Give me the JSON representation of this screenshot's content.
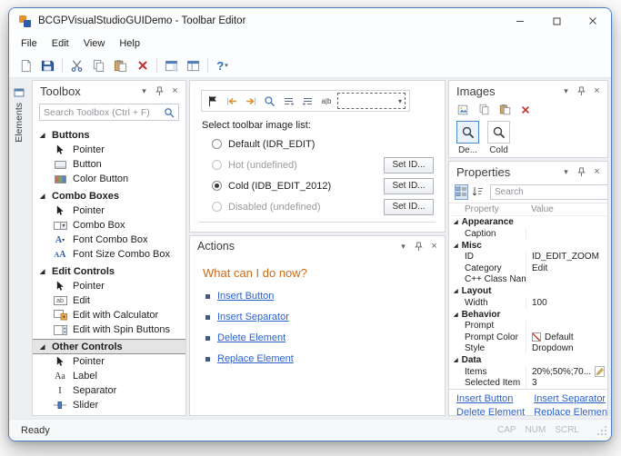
{
  "window": {
    "title": "BCGPVisualStudioGUIDemo - Toolbar Editor",
    "status_left": "Ready",
    "status_indicators": [
      "CAP",
      "NUM",
      "SCRL"
    ]
  },
  "colors": {
    "accent_blue": "#4a7fc1",
    "link_blue": "#2d62c9",
    "heading_orange": "#cd6a18",
    "delete_red": "#c4302b"
  },
  "menu": {
    "items": [
      "File",
      "Edit",
      "View",
      "Help"
    ]
  },
  "main_toolbar": {
    "icons": [
      "new",
      "save",
      "cut",
      "copy",
      "paste",
      "delete",
      "workspace",
      "windows",
      "help"
    ]
  },
  "left_tab": {
    "label": "Elements"
  },
  "toolbox": {
    "title": "Toolbox",
    "search_placeholder": "Search Toolbox (Ctrl + F)",
    "sections": [
      {
        "label": "Buttons",
        "expanded": true,
        "selected": false,
        "items": [
          {
            "label": "Pointer",
            "icon": "pointer"
          },
          {
            "label": "Button",
            "icon": "button"
          },
          {
            "label": "Color Button",
            "icon": "color-button"
          }
        ]
      },
      {
        "label": "Combo Boxes",
        "expanded": true,
        "selected": false,
        "items": [
          {
            "label": "Pointer",
            "icon": "pointer"
          },
          {
            "label": "Combo Box",
            "icon": "combo-box"
          },
          {
            "label": "Font Combo Box",
            "icon": "font-combo-box"
          },
          {
            "label": "Font Size Combo Box",
            "icon": "font-size-combo-box"
          }
        ]
      },
      {
        "label": "Edit Controls",
        "expanded": true,
        "selected": false,
        "items": [
          {
            "label": "Pointer",
            "icon": "pointer"
          },
          {
            "label": "Edit",
            "icon": "edit"
          },
          {
            "label": "Edit with Calculator",
            "icon": "edit-calculator"
          },
          {
            "label": "Edit with Spin Buttons",
            "icon": "edit-spin"
          }
        ]
      },
      {
        "label": "Other Controls",
        "expanded": true,
        "selected": true,
        "items": [
          {
            "label": "Pointer",
            "icon": "pointer"
          },
          {
            "label": "Label",
            "icon": "label"
          },
          {
            "label": "Separator",
            "icon": "separator"
          },
          {
            "label": "Slider",
            "icon": "slider"
          }
        ]
      }
    ]
  },
  "editor": {
    "strip_icons": [
      "flag",
      "move-back",
      "move-forward",
      "magnifier",
      "list-left",
      "list-right",
      "text-ab",
      "zoom-combobox"
    ],
    "select_label": "Select toolbar image list:",
    "radios": [
      {
        "label": "Default (IDR_EDIT)",
        "selected": false,
        "enabled": true,
        "button": ""
      },
      {
        "label": "Hot (undefined)",
        "selected": false,
        "enabled": false,
        "button": "Set ID..."
      },
      {
        "label": "Cold (IDB_EDIT_2012)",
        "selected": true,
        "enabled": true,
        "button": "Set ID..."
      },
      {
        "label": "Disabled (undefined)",
        "selected": false,
        "enabled": false,
        "button": "Set ID..."
      }
    ]
  },
  "actions": {
    "title": "Actions",
    "heading": "What can I do now?",
    "links": [
      "Insert Button",
      "Insert Separator",
      "Delete Element",
      "Replace Element"
    ]
  },
  "images": {
    "title": "Images",
    "toolbar_icons": [
      "new-image",
      "copy",
      "paste",
      "delete"
    ],
    "items": [
      {
        "label": "De...",
        "selected": true
      },
      {
        "label": "Cold",
        "selected": false
      }
    ]
  },
  "properties": {
    "title": "Properties",
    "toolbar_icons": [
      "categorized",
      "alphabetical"
    ],
    "search_placeholder": "Search",
    "columns": [
      "Property",
      "Value"
    ],
    "rows": [
      {
        "type": "category",
        "name": "Appearance"
      },
      {
        "type": "row",
        "name": "Caption",
        "value": ""
      },
      {
        "type": "category",
        "name": "Misc"
      },
      {
        "type": "row",
        "name": "ID",
        "value": "ID_EDIT_ZOOM"
      },
      {
        "type": "row",
        "name": "Category",
        "value": "Edit"
      },
      {
        "type": "row",
        "name": "C++ Class Name",
        "value": ""
      },
      {
        "type": "category",
        "name": "Layout"
      },
      {
        "type": "row",
        "name": "Width",
        "value": "100"
      },
      {
        "type": "category",
        "name": "Behavior"
      },
      {
        "type": "row",
        "name": "Prompt",
        "value": ""
      },
      {
        "type": "row",
        "name": "Prompt Color",
        "value": "Default",
        "swatch": true
      },
      {
        "type": "row",
        "name": "Style",
        "value": "Dropdown"
      },
      {
        "type": "category",
        "name": "Data"
      },
      {
        "type": "row",
        "name": "Items",
        "value": "20%;50%;70...",
        "editbtn": true
      },
      {
        "type": "row",
        "name": "Selected Item",
        "value": "3"
      }
    ],
    "links": [
      "Insert Button",
      "Insert Separator",
      "Delete Element",
      "Replace Element"
    ]
  }
}
